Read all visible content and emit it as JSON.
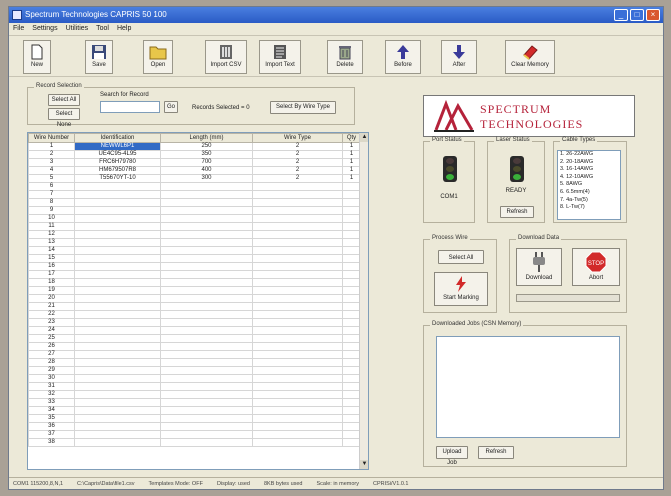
{
  "window": {
    "title": "Spectrum Technologies CAPRIS 50 100"
  },
  "menu": [
    "File",
    "Settings",
    "Utilities",
    "Tool",
    "Help"
  ],
  "toolbar": {
    "new": "New",
    "save": "Save",
    "open": "Open",
    "import_csv": "Import CSV",
    "import_text": "Import Text",
    "delete": "Delete",
    "before": "Before",
    "after": "After",
    "clear_memory": "Clear Memory"
  },
  "record_selection": {
    "title": "Record Selection",
    "select_all": "Select All",
    "select_none": "Select None",
    "search_label": "Search for Record",
    "search_value": "",
    "go": "Go",
    "records_selected": "Records Selected = 0",
    "select_by_wire_type": "Select By Wire Type"
  },
  "grid": {
    "columns": [
      "Wire Number",
      "Identification",
      "Length (mm)",
      "Wire Type",
      "Qty"
    ],
    "rows": [
      [
        "1",
        "NEWWL6P1",
        "250",
        "2",
        "1"
      ],
      [
        "2",
        "UE4C95-4L95",
        "350",
        "2",
        "1"
      ],
      [
        "3",
        "FRC6H79780",
        "700",
        "2",
        "1"
      ],
      [
        "4",
        "HM679507R8",
        "400",
        "2",
        "1"
      ],
      [
        "5",
        "T55670YT-10",
        "300",
        "2",
        "1"
      ]
    ],
    "empty_numbers": [
      "6",
      "7",
      "8",
      "9",
      "10",
      "11",
      "12",
      "13",
      "14",
      "15",
      "16",
      "17",
      "18",
      "19",
      "20",
      "21",
      "22",
      "23",
      "24",
      "25",
      "26",
      "27",
      "28",
      "29",
      "30",
      "31",
      "32",
      "33",
      "34",
      "35",
      "36",
      "37",
      "38"
    ]
  },
  "logo": {
    "line1": "SPECTRUM",
    "line2": "TECHNOLOGIES"
  },
  "port_status": {
    "title": "Port Status",
    "value": "COM1"
  },
  "laser_status": {
    "title": "Laser Status",
    "value": "READY",
    "refresh": "Refresh"
  },
  "cable_types": {
    "title": "Cable Types",
    "items": [
      "1. 26-22AWG",
      "2. 20-18AWG",
      "3. 16-14AWG",
      "4. 12-10AWG",
      "5. 8AWG",
      "6. 6.5mm(4)",
      "7. 4a-Tw(5)",
      "8. L-Tw(7)"
    ]
  },
  "process_wire": {
    "title": "Process Wire",
    "select_all": "Select All",
    "start_marking": "Start Marking"
  },
  "download_data": {
    "title": "Download Data",
    "download": "Download",
    "abort": "Abort"
  },
  "downloaded_jobs": {
    "title": "Downloaded Jobs (CSN Memory)",
    "upload": "Upload Job",
    "refresh": "Refresh"
  },
  "status_bar": [
    "COM1 115200,8,N,1",
    "C:\\Capris\\Data\\file1.csv",
    "Templates Mode: OFF",
    "Display: used",
    "8KB bytes used",
    "Scale: in memory",
    "CPRISi/V1.0.1"
  ],
  "colors": {
    "titlebar": "#2a5bc5",
    "logo_red": "#b5223a",
    "abort_red": "#d22a2a",
    "traffic_body": "#2a2a2a",
    "green_light": "#3ab03a"
  }
}
